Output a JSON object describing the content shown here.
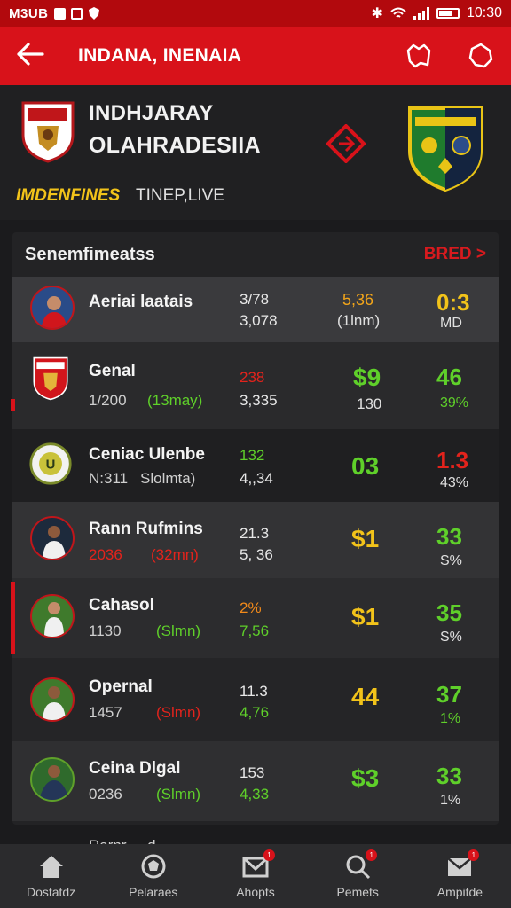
{
  "status_bar": {
    "left_text": "M3UB",
    "time": "10:30"
  },
  "app_bar": {
    "title": "INDANA, INENAIA"
  },
  "match": {
    "home_name_line1": "INDHJARAY",
    "home_name_line2": "OLAHRADESIIA",
    "tab_active": "IMDENFINES",
    "tab_inactive": "TINEP,LIVE"
  },
  "card": {
    "title": "Senemfimeatss",
    "link": "BRED >",
    "rows": [
      {
        "name": "Aeriai laatais",
        "sub": "",
        "sub2": "",
        "c1": "3/78",
        "c1b": "3,078",
        "c2": "5,36",
        "c2s": "(1lnm)",
        "c3": "0:3",
        "c3s": "MD"
      },
      {
        "name": "Genal",
        "sub": "1/200",
        "sub2": "(13may)",
        "c1": "238",
        "c1b": "3,335",
        "c2": "$9",
        "c2s": "130",
        "c3": "46",
        "c3s": "39%"
      },
      {
        "name": "Ceniac Ulenbe",
        "sub": "N:311",
        "sub2": "Slolmta)",
        "c1": "132",
        "c1b": "4,,34",
        "c2": "03",
        "c2s": "",
        "c3": "1.3",
        "c3s": "43%"
      },
      {
        "name": "Rann Rufmins",
        "sub": "2036",
        "sub2": "(32mn)",
        "c1": "21.3",
        "c1b": "5, 36",
        "c2": "$1",
        "c2s": "",
        "c3": "33",
        "c3s": "S%"
      },
      {
        "name": "Cahasol",
        "sub": "1130",
        "sub2": "(Slmn)",
        "c1": "2%",
        "c1b": "7,56",
        "c2": "$1",
        "c2s": "",
        "c3": "35",
        "c3s": "S%"
      },
      {
        "name": "Opernal",
        "sub": "1457",
        "sub2": "(Slmn)",
        "c1": "11.3",
        "c1b": "4,76",
        "c2": "44",
        "c2s": "",
        "c3": "37",
        "c3s": "1%"
      },
      {
        "name": "Ceina Dlgal",
        "sub": "0236",
        "sub2": "(Slmn)",
        "c1": "153",
        "c1b": "4,33",
        "c2": "$3",
        "c2s": "",
        "c3": "33",
        "c3s": "1%"
      }
    ]
  },
  "partial_row": {
    "name": "Rarnr ... d"
  },
  "bottom_nav": {
    "items": [
      {
        "label": "Dostatdz",
        "icon": "home-icon",
        "badge": ""
      },
      {
        "label": "Pelaraes",
        "icon": "ball-icon",
        "badge": ""
      },
      {
        "label": "Ahopts",
        "icon": "inbox-icon",
        "badge": "1"
      },
      {
        "label": "Pemets",
        "icon": "search-icon",
        "badge": "1"
      },
      {
        "label": "Ampitde",
        "icon": "mail-icon",
        "badge": "1"
      }
    ]
  },
  "colors": {
    "accent": "#d8121a",
    "gold": "#f2c31a",
    "green": "#5fd02a",
    "red": "#e3231c"
  }
}
